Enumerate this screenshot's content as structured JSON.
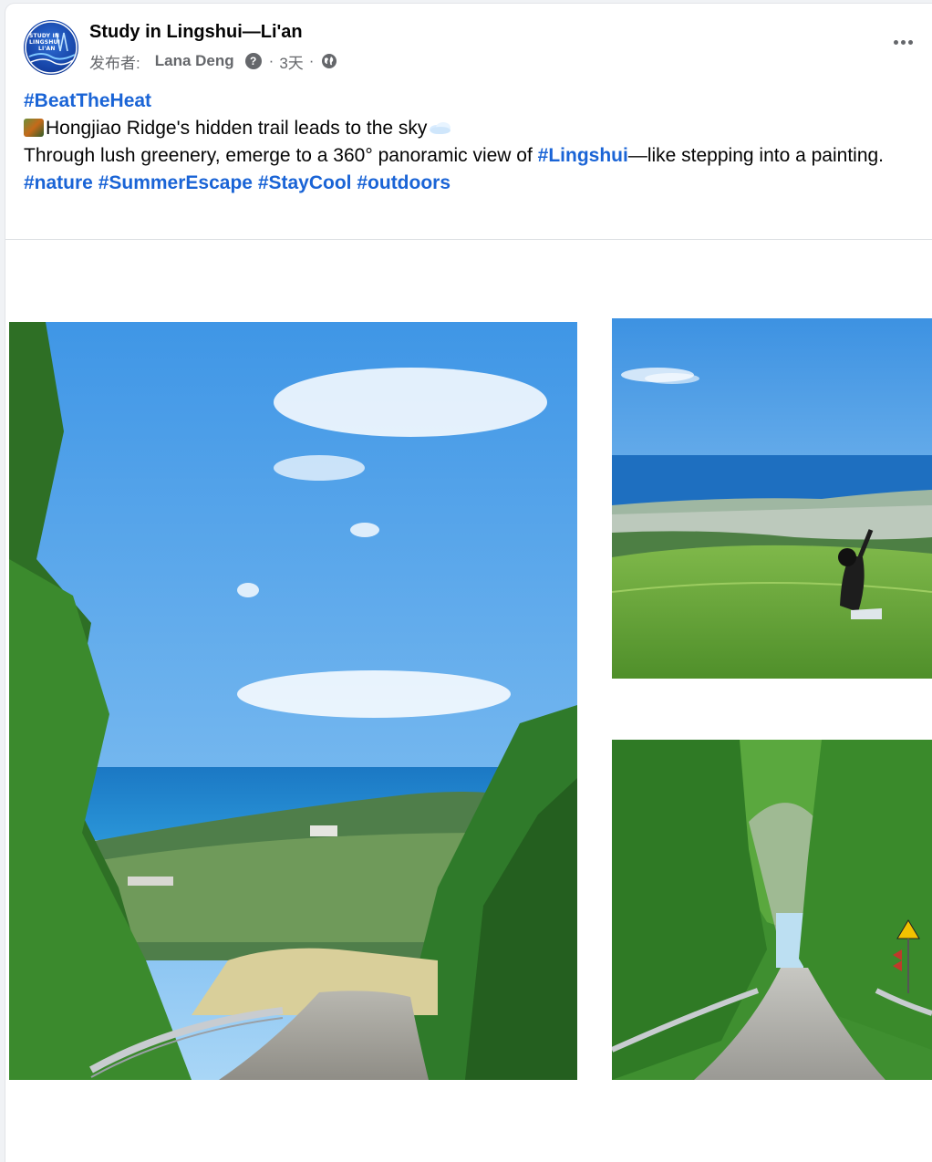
{
  "post": {
    "page_name": "Study in Lingshui—Li'an",
    "meta_label": "发布者:",
    "author": "Lana Deng",
    "help_mark": "?",
    "separator": "·",
    "time": "3天",
    "separator2": "·",
    "privacy_icon": "globe-icon",
    "avatar_text": [
      "STUDY IN",
      "LINGSHUI",
      "LI'AN"
    ]
  },
  "content": {
    "hashtag_top": "#BeatTheHeat",
    "line1": "Hongjiao Ridge's hidden trail leads to the sky",
    "line2_a": "Through lush greenery, emerge to a 360° panoramic view of ",
    "line2_tag": "#Lingshui",
    "line2_b": "—like stepping into a painting.",
    "tags": [
      "#nature",
      "#SummerEscape",
      "#StayCool",
      "#outdoors"
    ]
  },
  "photos": {
    "main": "Mountain road overlooking coastline",
    "top_right": "Person waving on grassy hill above town",
    "bottom_right": "Tree-lined mountain road"
  },
  "colors": {
    "link": "#1a64d6",
    "secondary_text": "#65676b",
    "sky": "#4a9be0",
    "sea": "#1f7fc9",
    "foliage": "#2f7a2a"
  }
}
